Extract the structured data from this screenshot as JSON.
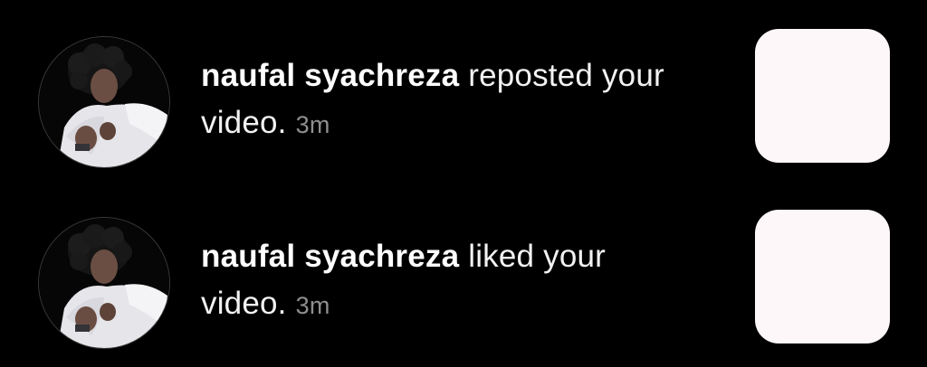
{
  "notifications": [
    {
      "username": "naufal syachreza",
      "action": " reposted your video.",
      "time": "3m",
      "avatar_icon": "user-avatar-photo",
      "thumbnail_color": "#fdf7f9"
    },
    {
      "username": "naufal syachreza",
      "action": " liked your video.",
      "time": "3m",
      "avatar_icon": "user-avatar-photo",
      "thumbnail_color": "#fdf7f9"
    }
  ],
  "colors": {
    "background": "#000000",
    "text_primary": "#ffffff",
    "text_secondary": "#8e8e8e"
  }
}
